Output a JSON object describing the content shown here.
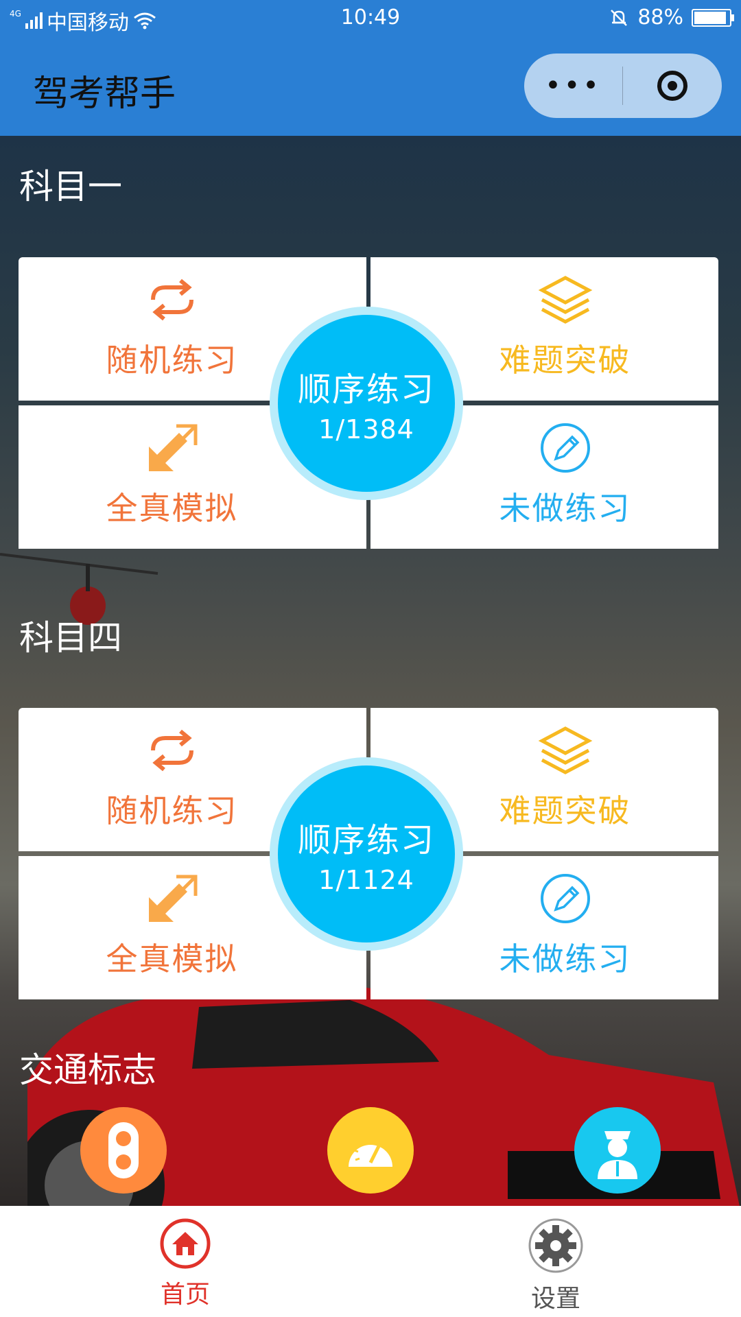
{
  "status_bar": {
    "network": "4G",
    "carrier": "中国移动",
    "time": "10:49",
    "battery": "88%"
  },
  "header": {
    "title": "驾考帮手",
    "more_icon": "more-dots-icon",
    "close_icon": "target-close-icon"
  },
  "subject1": {
    "title": "科目一",
    "random": "随机练习",
    "hard": "难题突破",
    "mock": "全真模拟",
    "undone": "未做练习",
    "sequential": "顺序练习",
    "progress": "1/1384"
  },
  "subject4": {
    "title": "科目四",
    "random": "随机练习",
    "hard": "难题突破",
    "mock": "全真模拟",
    "undone": "未做练习",
    "sequential": "顺序练习",
    "progress": "1/1124"
  },
  "traffic": {
    "title": "交通标志",
    "items": [
      {
        "icon": "traffic-light-icon",
        "color": "#ff8a3d"
      },
      {
        "icon": "speedometer-icon",
        "color": "#ffcf2e"
      },
      {
        "icon": "traffic-police-icon",
        "color": "#18c8ef"
      }
    ]
  },
  "tabbar": {
    "home": "首页",
    "settings": "设置"
  },
  "colors": {
    "primary": "#2a7fd4",
    "orange": "#f1743a",
    "yellow": "#f7b920",
    "blue": "#23aef0",
    "circle": "#00bdf7",
    "active_tab": "#e0322a"
  }
}
